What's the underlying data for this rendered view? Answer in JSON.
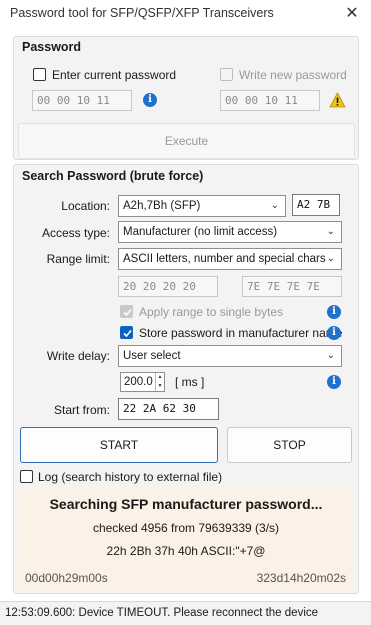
{
  "window": {
    "title": "Password tool for SFP/QSFP/XFP Transceivers",
    "close_glyph": "✕"
  },
  "password_group": {
    "title": "Password",
    "enter_current": {
      "label": "Enter current password",
      "checked": false
    },
    "write_new": {
      "label": "Write new password",
      "checked": false,
      "enabled": false
    },
    "current_hex": "00 00 10 11",
    "new_hex": "00 00 10 11",
    "execute_label": "Execute",
    "info_glyph": "i",
    "warning_glyph": "!"
  },
  "search_group": {
    "title": "Search Password (brute force)",
    "location": {
      "label": "Location:",
      "value": "A2h,7Bh (SFP)",
      "hex": "A2 7B"
    },
    "access_type": {
      "label": "Access type:",
      "value": "Manufacturer (no limit access)"
    },
    "range_limit": {
      "label": "Range limit:",
      "value": "ASCII letters, number and special chars",
      "from_hex": "20 20 20 20",
      "to_hex": "7E 7E 7E 7E"
    },
    "apply_range": {
      "label": "Apply range to single bytes",
      "checked": true,
      "enabled": false
    },
    "store_password": {
      "label": "Store password in manufacturer name",
      "checked": true
    },
    "write_delay": {
      "label": "Write delay:",
      "value": "User select",
      "amount": "200.0",
      "unit": "[ ms ]"
    },
    "start_from": {
      "label": "Start from:",
      "hex": "22 2A 62 30"
    },
    "start_label": "START",
    "stop_label": "STOP",
    "log": {
      "label": "Log (search history to external file)",
      "checked": false
    }
  },
  "progress": {
    "headline": "Searching SFP manufacturer password...",
    "checked_line": "checked 4956 from 79639339 (3/s)",
    "current_line": "22h 2Bh 37h 40h  ASCII:\"+7@",
    "elapsed": "00d00h29m00s",
    "remaining": "323d14h20m02s"
  },
  "status_bar": {
    "text": "12:53:09.600: Device TIMEOUT. Please reconnect the device"
  },
  "colors": {
    "accent": "#1f72cc",
    "warning": "#f0c419",
    "progress_bg": "#fbf1e6"
  }
}
